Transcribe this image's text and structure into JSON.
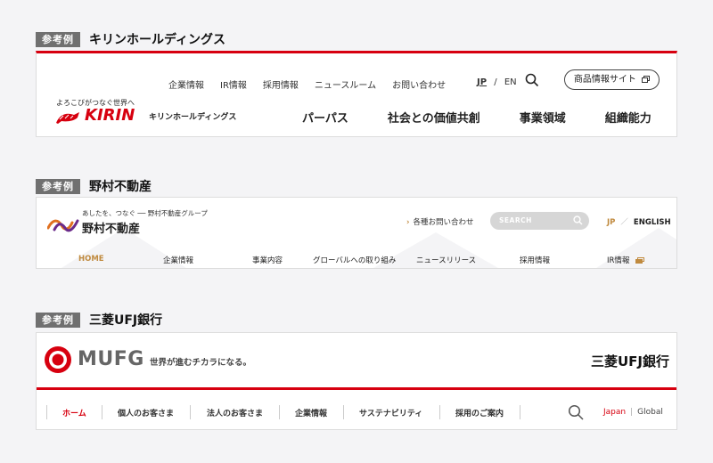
{
  "label": "参考例",
  "kirin": {
    "company": "キリンホールディングス",
    "tagline": "よろこびがつなぐ世界へ",
    "logo_word": "KIRIN",
    "logo_name": "キリンホールディングス",
    "utility_nav": [
      "企業情報",
      "IR情報",
      "採用情報",
      "ニュースルーム",
      "お問い合わせ"
    ],
    "lang_jp": "JP",
    "lang_sep": "/",
    "lang_en": "EN",
    "site_button": "商品情報サイト",
    "main_nav": [
      "パーパス",
      "社会との価値共創",
      "事業領域",
      "組織能力"
    ],
    "accent_color": "#d7000f"
  },
  "nomura": {
    "company": "野村不動産",
    "slogan": "あしたを、つなぐ ── 野村不動産グループ",
    "logo_name": "野村不動産",
    "contact": "各種お問い合わせ",
    "search_placeholder": "SEARCH",
    "lang_jp": "JP",
    "lang_sep": "／",
    "lang_en": "ENGLISH",
    "nav": [
      "HOME",
      "企業情報",
      "事業内容",
      "グローバルへの取り組み",
      "ニュースリリース",
      "採用情報",
      "IR情報"
    ],
    "accent_color": "#c08a3e"
  },
  "mufg": {
    "company": "三菱UFJ銀行",
    "logo_word": "MUFG",
    "slogan": "世界が進むチカラになる。",
    "bank_name": "三菱UFJ銀行",
    "nav": [
      "ホーム",
      "個人のお客さま",
      "法人のお客さま",
      "企業情報",
      "サステナビリティ",
      "採用のご案内"
    ],
    "lang_jp": "Japan",
    "lang_sep": "|",
    "lang_en": "Global",
    "accent_color": "#d7000f"
  }
}
